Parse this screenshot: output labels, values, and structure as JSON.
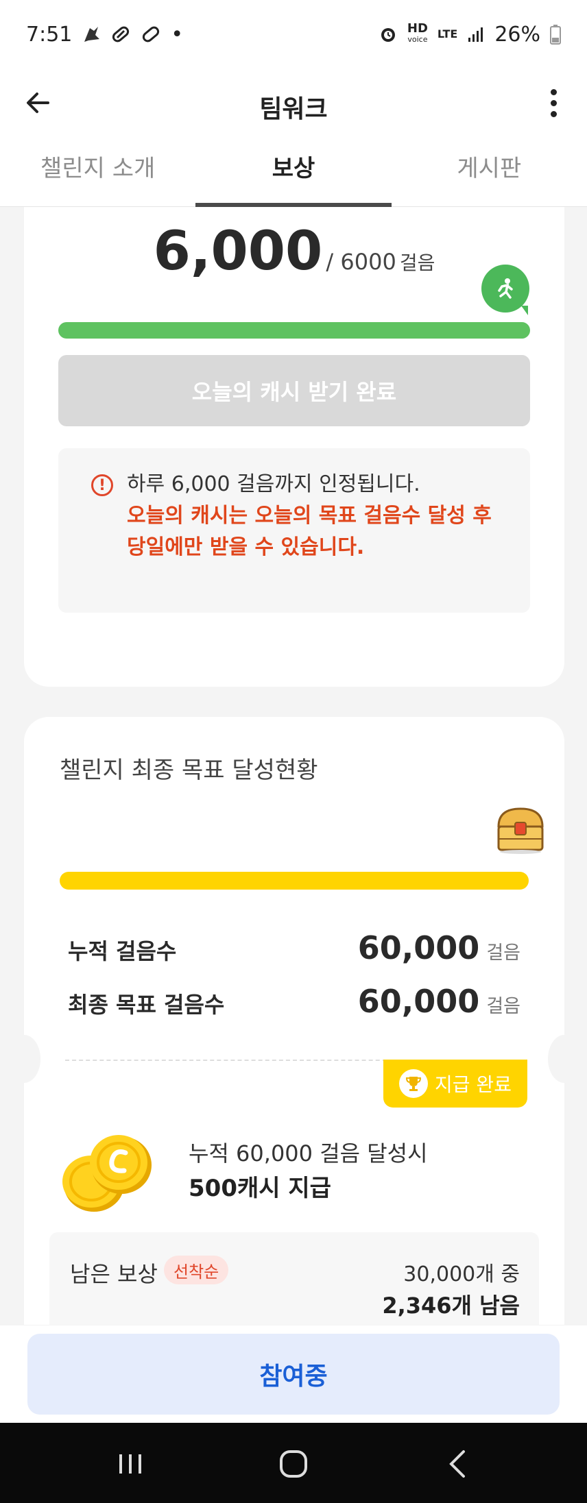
{
  "status_bar": {
    "time": "7:51",
    "dot": "•",
    "hd_label_top": "HD",
    "hd_label_bottom": "voice",
    "lte_label": "LTE",
    "battery": "26%",
    "icons": [
      "notification-icon",
      "pill-icon",
      "link-icon",
      "alarm-icon",
      "signal-icon",
      "battery-icon"
    ]
  },
  "app_bar": {
    "title": "팀워크",
    "icons": [
      "back-arrow-icon",
      "more-vert-icon"
    ]
  },
  "tabs": [
    {
      "label": "챌린지 소개",
      "active": false
    },
    {
      "label": "보상",
      "active": true
    },
    {
      "label": "게시판",
      "active": false
    }
  ],
  "daily": {
    "steps": "6,000",
    "goal": "/ 6000",
    "unit": "걸음",
    "progress": 1.0,
    "button_label": "오늘의 캐시 받기 완료",
    "notice_icon": "!",
    "notice_line": "하루 6,000 걸음까지 인정됩니다.",
    "notice_red_1": "오늘의 캐시는 오늘의 목표 걸음수 달성 후",
    "notice_red_2": "당일에만 받을 수 있습니다."
  },
  "final": {
    "title": "챌린지 최종 목표 달성현황",
    "progress": 1.0,
    "cumulative_label": "누적 걸음수",
    "cumulative_value": "60,000",
    "cumulative_unit": "걸음",
    "goal_label": "최종 목표 걸음수",
    "goal_value": "60,000",
    "goal_unit": "걸음",
    "paid_badge": "지급 완료",
    "reward_condition": "누적 60,000 걸음 달성시",
    "reward_amount": "500캐시 지급",
    "remain_label": "남은 보상",
    "first_come_badge": "선착순",
    "remain_total": "30,000개 중",
    "remain_left": "2,346개 남음"
  },
  "bottom": {
    "join_button": "참여중"
  },
  "colors": {
    "green": "#5ec260",
    "yellow": "#ffd400",
    "red_text": "#e0461b",
    "blue_text": "#1a5fd6",
    "join_bg": "#e5ecfc"
  }
}
